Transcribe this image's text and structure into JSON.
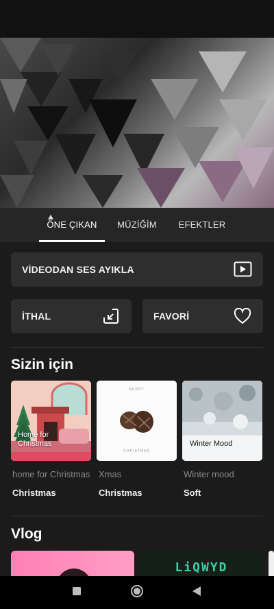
{
  "tabs": [
    {
      "label": "ÖNE ÇIKAN",
      "active": true
    },
    {
      "label": "MÜZİĞİM",
      "active": false
    },
    {
      "label": "EFEKTLER",
      "active": false
    }
  ],
  "actions": {
    "extract_audio": "VİDEODAN SES AYIKLA",
    "import": "İTHAL",
    "favorites": "FAVORİ"
  },
  "sections": {
    "for_you": "Sizin için",
    "vlog": "Vlog"
  },
  "cards": [
    {
      "cover_text": "Home for Christmas",
      "subtitle": "home for Christmas",
      "tag": "Christmas"
    },
    {
      "cover_text_top": "MERRY",
      "cover_text_bottom": "CHRISTMAS",
      "subtitle": "Xmas",
      "tag": "Christmas"
    },
    {
      "cover_text": "Winter Mood",
      "subtitle": "Winter mood",
      "tag": "Soft"
    }
  ],
  "vlog_cards": [
    {
      "cover_text": ""
    },
    {
      "cover_text": "LiQWYD"
    }
  ],
  "icons": {
    "extract_audio": "play-box-icon",
    "import": "import-arrow-icon",
    "favorites": "heart-icon",
    "nav_recents": "square-icon",
    "nav_home": "circle-icon",
    "nav_back": "back-triangle-icon"
  }
}
